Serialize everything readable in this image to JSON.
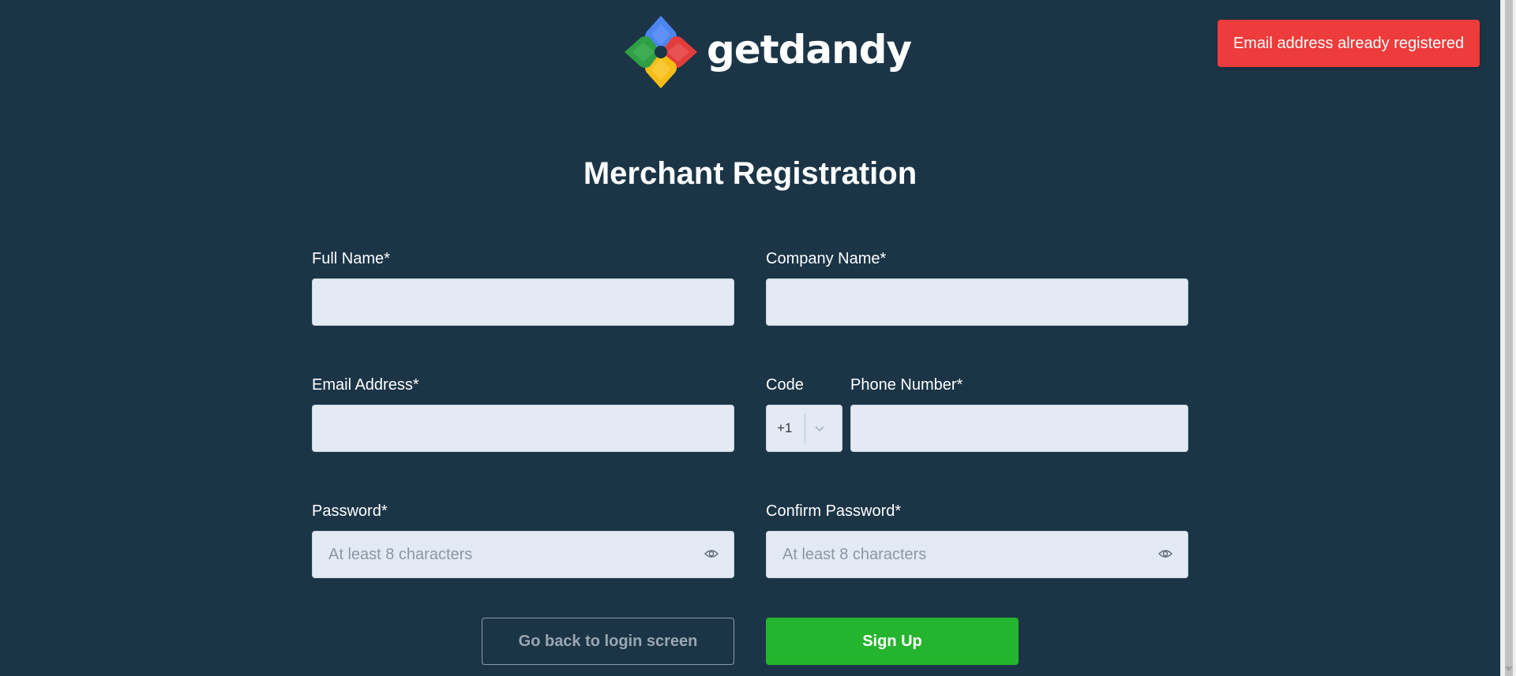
{
  "brand": {
    "name": "getdandy",
    "logo_colors": [
      "#4285f4",
      "#ea4335",
      "#fbbc05",
      "#34a853"
    ]
  },
  "toast": {
    "message": "Email address already registered",
    "color": "#ee3b3b"
  },
  "form": {
    "title": "Merchant Registration",
    "full_name": {
      "label": "Full Name*",
      "value": "",
      "placeholder": ""
    },
    "company_name": {
      "label": "Company Name*",
      "value": "",
      "placeholder": ""
    },
    "email": {
      "label": "Email Address*",
      "value": "",
      "placeholder": ""
    },
    "code": {
      "label": "Code",
      "value": "+1"
    },
    "phone": {
      "label": "Phone Number*",
      "value": "",
      "placeholder": ""
    },
    "password": {
      "label": "Password*",
      "placeholder": "At least 8 characters",
      "icon": "eye-icon"
    },
    "confirm_password": {
      "label": "Confirm Password*",
      "placeholder": "At least 8 characters",
      "icon": "eye-icon"
    }
  },
  "actions": {
    "back_label": "Go back to login screen",
    "signup_label": "Sign Up",
    "signup_color": "#25b42d"
  }
}
